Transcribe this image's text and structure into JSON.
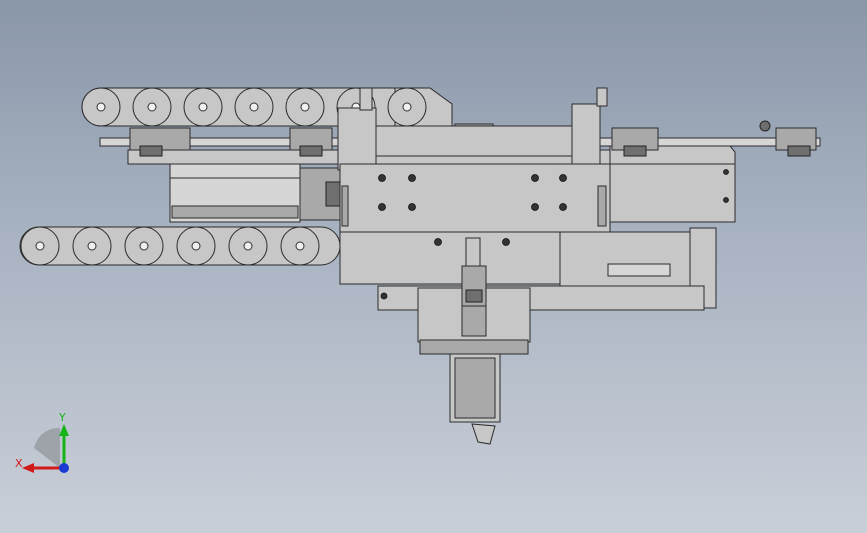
{
  "viewport": {
    "background_top": "#8a97a9",
    "background_bottom": "#c9cfd8",
    "part_fill": "#c6c6c6",
    "part_stroke": "#2b2b2b"
  },
  "triad": {
    "x_label": "X",
    "y_label": "Y",
    "x_color": "#d11a1a",
    "y_color": "#16b416",
    "z_color": "#1a3ad1"
  }
}
